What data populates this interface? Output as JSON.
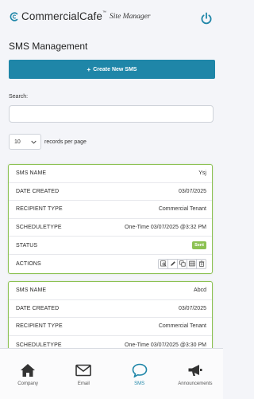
{
  "header": {
    "brand": "CommercialCafe",
    "brand_tm": "™",
    "brand_sub": "Site Manager"
  },
  "page": {
    "title": "SMS Management"
  },
  "toolbar": {
    "create_label": "Create New SMS"
  },
  "search": {
    "label": "Search:",
    "value": "",
    "placeholder": ""
  },
  "pagination": {
    "page_size": "10",
    "records_label": "records per page"
  },
  "records": [
    {
      "sms_name_label": "SMS NAME",
      "sms_name": "Ysj",
      "date_created_label": "DATE CREATED",
      "date_created": "03/07/2025",
      "recipient_type_label": "RECIPIENT TYPE",
      "recipient_type": "Commercial Tenant",
      "schedule_type_label": "SCHEDULETYPE",
      "schedule_type": "One-Time 03/07/2025 @3:32 PM",
      "status_label": "STATUS",
      "status": "Sent",
      "actions_label": "ACTIONS"
    },
    {
      "sms_name_label": "SMS NAME",
      "sms_name": "Abcd",
      "date_created_label": "DATE CREATED",
      "date_created": "03/07/2025",
      "recipient_type_label": "RECIPIENT TYPE",
      "recipient_type": "Commercial Tenant",
      "schedule_type_label": "SCHEDULETYPE",
      "schedule_type": "One-Time 03/07/2025 @3:30 PM"
    }
  ],
  "nav": {
    "items": [
      {
        "label": "Company",
        "icon": "home-icon"
      },
      {
        "label": "Email",
        "icon": "envelope-icon"
      },
      {
        "label": "SMS",
        "icon": "chat-bubble-icon",
        "active": true
      },
      {
        "label": "Announcements",
        "icon": "megaphone-icon"
      }
    ]
  },
  "colors": {
    "accent": "#1f86a8",
    "success": "#8cc152",
    "background": "#f4f5f9"
  }
}
